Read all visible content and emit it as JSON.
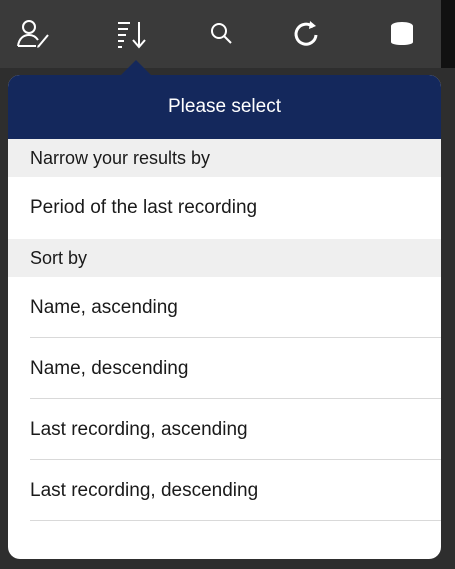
{
  "popover": {
    "title": "Please select",
    "sections": [
      {
        "header": "Narrow your results by",
        "items": [
          "Period of the last recording"
        ]
      },
      {
        "header": "Sort by",
        "items": [
          "Name, ascending",
          "Name, descending",
          "Last recording, ascending",
          "Last recording, descending"
        ]
      }
    ]
  },
  "toolbar": {
    "icons": [
      "user-edit-icon",
      "sort-icon",
      "search-icon",
      "refresh-icon",
      "database-icon"
    ],
    "icon_color": "#ffffff"
  },
  "colors": {
    "header_bg": "#14285c",
    "section_bg": "#efefef"
  }
}
